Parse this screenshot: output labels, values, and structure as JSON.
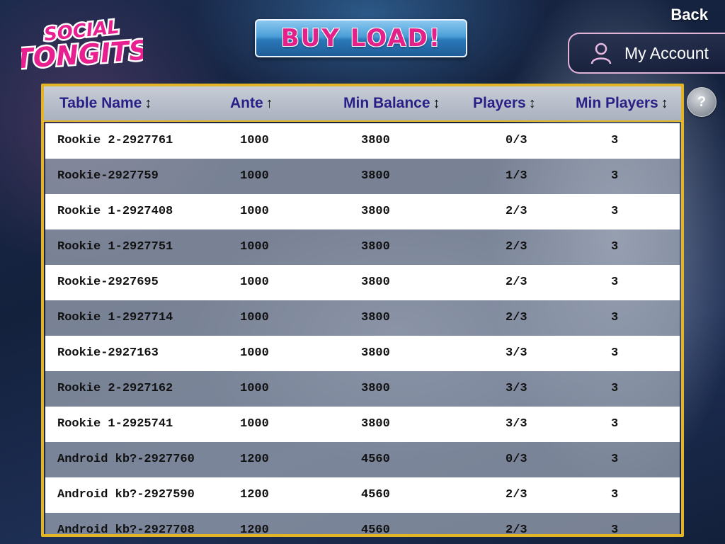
{
  "logo": {
    "line1": "SOCIAL",
    "line2": "TONGITS"
  },
  "buy_load": {
    "label": "BUY LOAD!"
  },
  "nav": {
    "back_label": "Back"
  },
  "account": {
    "label": "My Account"
  },
  "help": {
    "label": "?"
  },
  "colors": {
    "accent_gold": "#e3b526",
    "header_text": "#2a1f86",
    "brand_pink": "#e3218b"
  },
  "table": {
    "headers": [
      {
        "label": "Table Name",
        "sort": "↕"
      },
      {
        "label": "Ante",
        "sort": "↑"
      },
      {
        "label": "Min Balance",
        "sort": "↕"
      },
      {
        "label": "Players",
        "sort": "↕"
      },
      {
        "label": "Min Players",
        "sort": "↕"
      }
    ],
    "rows": [
      [
        "Rookie 2-2927761",
        "1000",
        "3800",
        "0/3",
        "3"
      ],
      [
        "Rookie-2927759",
        "1000",
        "3800",
        "1/3",
        "3"
      ],
      [
        "Rookie 1-2927408",
        "1000",
        "3800",
        "2/3",
        "3"
      ],
      [
        "Rookie 1-2927751",
        "1000",
        "3800",
        "2/3",
        "3"
      ],
      [
        "Rookie-2927695",
        "1000",
        "3800",
        "2/3",
        "3"
      ],
      [
        "Rookie 1-2927714",
        "1000",
        "3800",
        "2/3",
        "3"
      ],
      [
        "Rookie-2927163",
        "1000",
        "3800",
        "3/3",
        "3"
      ],
      [
        "Rookie 2-2927162",
        "1000",
        "3800",
        "3/3",
        "3"
      ],
      [
        "Rookie 1-2925741",
        "1000",
        "3800",
        "3/3",
        "3"
      ],
      [
        "Android kb?-2927760",
        "1200",
        "4560",
        "0/3",
        "3"
      ],
      [
        "Android kb?-2927590",
        "1200",
        "4560",
        "2/3",
        "3"
      ],
      [
        "Android kb?-2927708",
        "1200",
        "4560",
        "2/3",
        "3"
      ]
    ]
  }
}
